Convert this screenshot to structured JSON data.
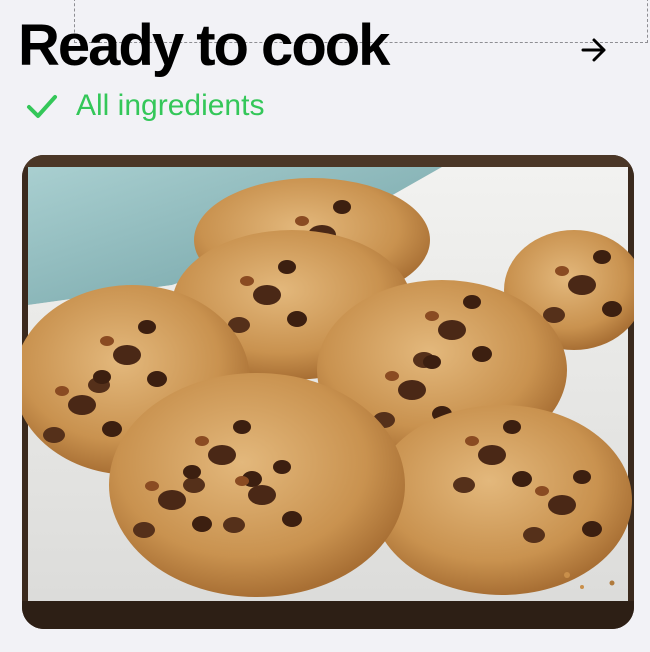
{
  "header": {
    "title": "Ready to cook",
    "next_icon": "arrow-right-icon"
  },
  "status": {
    "icon": "checkmark-icon",
    "label": "All ingredients",
    "color": "#34c759"
  },
  "photo": {
    "subject": "chocolate-chip-cookies-on-plate"
  },
  "colors": {
    "background": "#f2f2f6",
    "text": "#000000",
    "accent": "#34c759"
  }
}
